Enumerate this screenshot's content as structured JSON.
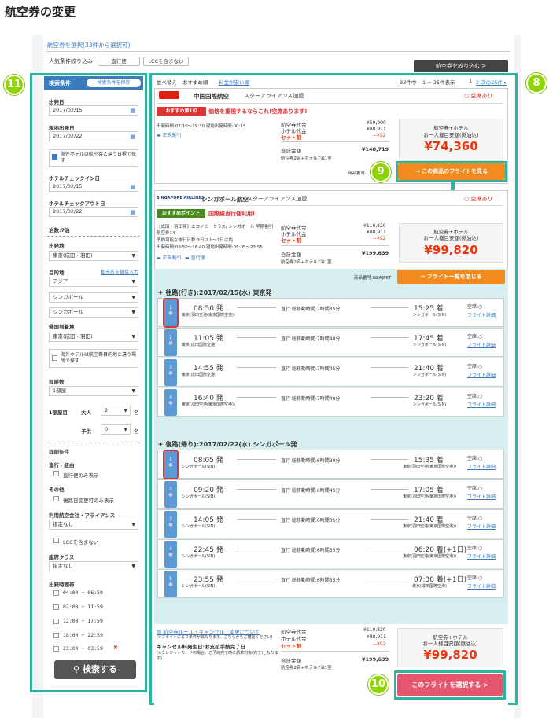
{
  "heading": "航空券の変更",
  "page_caption": "航空券を選択(33件から選択可)",
  "filters": {
    "label": "人気条件絞り込み",
    "btn1": "直行便",
    "btn2": "LCCを含まない",
    "narrow": "航空券を絞り込む >"
  },
  "markers": {
    "m8": "8",
    "m9": "9",
    "m10": "10",
    "m11": "11"
  },
  "sort": {
    "label": "並べ替え",
    "opt1": "おすすめ順",
    "opt2": "料金が安い順",
    "count": "33件中",
    "range": "1 − 25件表示",
    "pages": "1",
    "next": "2 次の25件 ▸"
  },
  "sidebar": {
    "title": "検索条件",
    "save": "検索条件を保存",
    "dep_label": "出発日",
    "dep": "2017/02/15",
    "ret_label": "現地出発日",
    "ret": "2017/02/22",
    "hotel_check": "海外ホテルは航空券と違う日程で探す",
    "checkin_label": "ホテルチェックイン日",
    "checkin": "2017/02/15",
    "checkout_label": "ホテルチェックアウト日",
    "checkout": "2017/02/22",
    "nights": "泊数:7泊",
    "from_label": "出発地",
    "from": "東京(成田・羽田)",
    "dest_label": "目的地",
    "dest_link": "都市名を直接入力",
    "dest1": "アジア",
    "dest2": "シンガポール",
    "dest3": "シンガポール",
    "return_label": "帰国到着地",
    "return": "東京(成田・羽田)",
    "hotel_dest": "海外ホテルは航空券目的地と違う場所で探す",
    "rooms_label": "部屋数",
    "rooms": "1部屋",
    "room1": "1部屋目",
    "adult": "大人",
    "adult_n": "2",
    "child": "子供",
    "child_n": "0",
    "unit": "名",
    "detail": "詳細条件",
    "direct_label": "直行・経由",
    "direct": "直行便のみ表示",
    "other_label": "その他",
    "other": "復路日変更可のみ表示",
    "airline_label": "利用航空会社・アライアンス",
    "airline": "指定なし",
    "lcc": "LCCを含まない",
    "class_label": "座席クラス",
    "class": "指定なし",
    "time_label": "出発時間帯",
    "times": [
      "04:00 − 06:59",
      "07:00 − 11:59",
      "12:00 − 17:59",
      "18:00 − 22:59",
      "23:00 − 03:59"
    ],
    "search": "検索する"
  },
  "card1": {
    "airline": "中国国際航空",
    "alliance": "スターアライアンス加盟",
    "avail": "空席あり",
    "badge": "おすすめ第1位",
    "promo": "価格を重視するならこれ!空席あります!",
    "times": "出発時間:07:10〜19:30  現地出発時間:00:15",
    "regular": "正規割引",
    "fare_lbl": "航空券代金",
    "fare": "¥59,900",
    "hotel_lbl": "ホテル代金",
    "hotel": "¥88,911",
    "set_lbl": "セット割",
    "set": "−¥92",
    "total_lbl": "合計金額",
    "total": "¥148,719",
    "note": "航空券2名+ホテル7泊1室",
    "box_title": "航空券+ホテル",
    "box_sub": "お一人様目安額(燃油込)",
    "box_price": "¥74,360",
    "product": "商品番号:",
    "btn": "→ この商品のフライトを見る"
  },
  "card2": {
    "airline": "シンガポール航空",
    "alliance": "スターアライアンス加盟",
    "avail": "空席あり",
    "badge": "おすすめポイント",
    "promo": "国際線直行便利用!",
    "d1": "《成田・羽田発》エコノミークラス/ シンガポール 早期割引",
    "d2": "航空券14",
    "d3": "予約可能な旅行日数:3日以上〜7日以内",
    "times": "出発時間:08:50〜16:40  現地出発時間:05:05〜23:55",
    "regular": "正規割引",
    "direct": "直行便",
    "fare_lbl": "航空券代金",
    "fare": "¥110,820",
    "hotel_lbl": "ホテル代金",
    "hotel": "¥88,911",
    "set_lbl": "セット割",
    "set": "−¥92",
    "total_lbl": "合計金額",
    "total": "¥199,639",
    "note": "航空券2名+ホテル7泊1室",
    "box_title": "航空券+ホテル",
    "box_sub": "お一人様目安額(燃油込)",
    "box_price": "¥99,820",
    "product": "商品番号:NZAJP6T",
    "btn": "→ フライト一覧を閉じる"
  },
  "outbound": {
    "title": "往路(行き):2017/02/15(水) 東京発",
    "flights": [
      {
        "n": "1",
        "dep": "08:50 発",
        "from": "東京(羽田空港(東京国際空港))",
        "dur": "直行 総移動時間:7時間35分",
        "arr": "15:25 着",
        "to": "シンガポール(SIN)",
        "seat": "空席:○",
        "detail": "フライト詳細"
      },
      {
        "n": "2",
        "dep": "11:05 発",
        "from": "東京(成田国際空港)",
        "dur": "直行 総移動時間:7時間40分",
        "arr": "17:45 着",
        "to": "シンガポール(SIN)",
        "seat": "空席:○",
        "detail": "フライト詳細"
      },
      {
        "n": "3",
        "dep": "14:55 発",
        "from": "東京(成田国際空港)",
        "dur": "直行 総移動時間:7時間45分",
        "arr": "21:40 着",
        "to": "シンガポール(SIN)",
        "seat": "空席:○",
        "detail": "フライト詳細"
      },
      {
        "n": "4",
        "dep": "16:40 発",
        "from": "東京(羽田空港(東京国際空港))",
        "dur": "直行 総移動時間:7時間40分",
        "arr": "23:20 着",
        "to": "シンガポール(SIN)",
        "seat": "空席:○",
        "detail": "フライト詳細"
      }
    ]
  },
  "inbound": {
    "title": "復路(帰り):2017/02/22(水) シンガポール発",
    "flights": [
      {
        "n": "1",
        "dep": "08:05 発",
        "from": "シンガポール(SIN)",
        "dur": "直行 総移動時間:6時間30分",
        "arr": "15:35 着",
        "to": "東京(羽田空港(東京国際空港))",
        "seat": "空席:○",
        "detail": "フライト詳細"
      },
      {
        "n": "2",
        "dep": "09:20 発",
        "from": "シンガポール(SIN)",
        "dur": "直行 総移動時間:6時間45分",
        "arr": "17:05 着",
        "to": "東京(羽田空港(東京国際空港))",
        "seat": "空席:○",
        "detail": "フライト詳細"
      },
      {
        "n": "3",
        "dep": "14:05 発",
        "from": "シンガポール(SIN)",
        "dur": "直行 総移動時間:6時間35分",
        "arr": "21:40 着",
        "to": "東京(羽田空港(東京国際空港))",
        "seat": "空席:○",
        "detail": "フライト詳細"
      },
      {
        "n": "4",
        "dep": "22:45 発",
        "from": "シンガポール(SIN)",
        "dur": "直行 総移動時間:6時間35分",
        "arr": "06:20 着(+1日)",
        "to": "東京(羽田空港(東京国際空港))",
        "seat": "空席:○",
        "detail": "フライト詳細"
      },
      {
        "n": "5",
        "dep": "23:55 発",
        "from": "シンガポール(SIN)",
        "dur": "直行 総移動時間:6時間35分",
        "arr": "07:30 着(+1日)",
        "to": "東京(成田国際空港)",
        "seat": "空席:○",
        "detail": "フライト詳細"
      }
    ]
  },
  "summary": {
    "rule": "航空券ルール・キャンセル・変更について",
    "rule_note": "(※フライトにより条件が異なります。こちらからご確認ください)",
    "cancel": "キャンセル料発生日:お支払手続完了日",
    "cancel_note": "(※クレジットカードの場合、ご予約完了時に請求対象(完了)となります)",
    "fare_lbl": "航空券代金",
    "fare": "¥110,820",
    "hotel_lbl": "ホテル代金",
    "hotel": "¥88,911",
    "set_lbl": "セット割",
    "set": "−¥92",
    "total_lbl": "合計金額",
    "total": "¥199,639",
    "note": "航空券2名+ホテル7泊1室",
    "box_title": "航空券+ホテル",
    "box_sub": "お一人様目安額(燃油込)",
    "box_price": "¥99,820",
    "select": "このフライトを選択する >"
  }
}
